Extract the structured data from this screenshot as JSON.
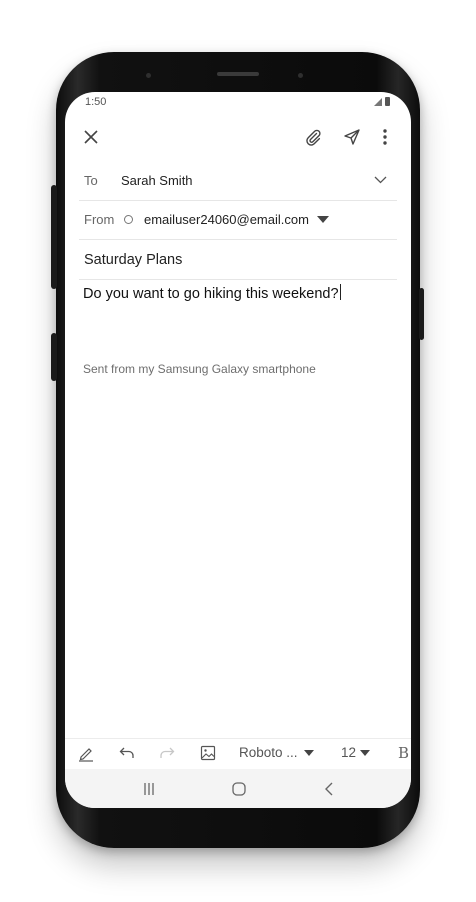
{
  "status": {
    "time": "1:50"
  },
  "email": {
    "to_label": "To",
    "to_value": "Sarah Smith",
    "from_label": "From",
    "from_value": "emailuser24060@email.com",
    "subject": "Saturday Plans",
    "body": "Do you want to go hiking this weekend?",
    "signature": "Sent from my Samsung Galaxy smartphone"
  },
  "toolbar": {
    "font": "Roboto ...",
    "size": "12",
    "bold": "B"
  },
  "icons": {
    "close": "close-icon",
    "attach": "paperclip-icon",
    "send": "send-icon",
    "more": "more-vert-icon",
    "pen": "pen-icon",
    "undo": "undo-icon",
    "redo": "redo-icon",
    "image": "image-icon",
    "recents": "recents-icon",
    "home": "home-icon",
    "back": "back-icon"
  }
}
